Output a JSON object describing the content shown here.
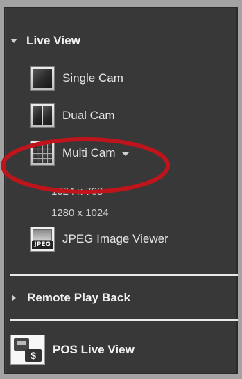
{
  "live_view": {
    "header": "Live View",
    "items": [
      {
        "label": "Single Cam",
        "icon": "single-camera-icon"
      },
      {
        "label": "Dual Cam",
        "icon": "dual-camera-icon"
      },
      {
        "label": "Multi Cam",
        "icon": "multi-camera-icon"
      }
    ],
    "multi_cam_options": [
      "1024 x 768",
      "1280 x 1024"
    ],
    "jpeg_viewer": {
      "label": "JPEG Image Viewer",
      "icon_text": "JPEG"
    }
  },
  "remote_play_back": {
    "header": "Remote Play Back"
  },
  "pos_live_view": {
    "label": "POS Live View",
    "icon_text": "$"
  },
  "colors": {
    "panel_bg": "#383838",
    "text": "#e6e6e6",
    "annotation": "#c0141c"
  }
}
